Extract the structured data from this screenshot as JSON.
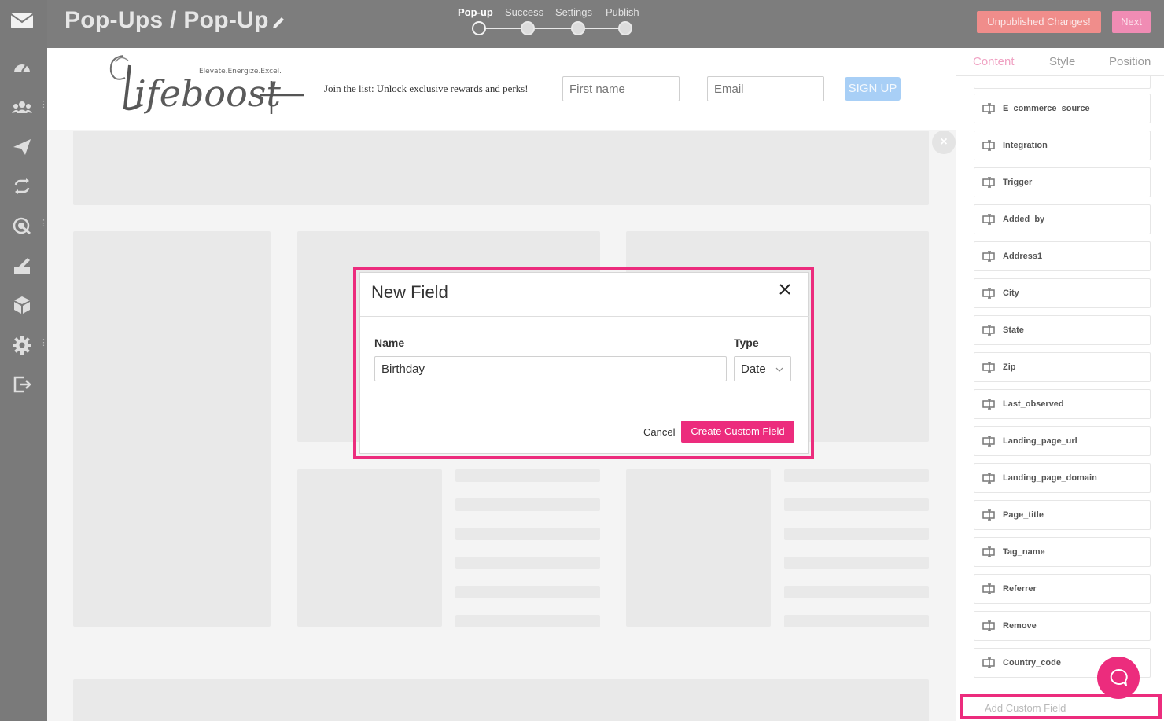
{
  "header": {
    "title": "Pop-Ups / Pop-Up",
    "steps": [
      "Pop-up",
      "Success",
      "Settings",
      "Publish"
    ],
    "active_step": "Pop-up",
    "unpublished_label": "Unpublished Changes!",
    "next_label": "Next"
  },
  "popup": {
    "brand_tagline": "Elevate.Energize.Excel.",
    "join_text": "Join the list: Unlock exclusive rewards and perks!",
    "first_name_placeholder": "First name",
    "email_placeholder": "Email",
    "signup_label": "SIGN UP",
    "close_label": "×"
  },
  "panel": {
    "tabs": [
      "Content",
      "Style",
      "Position"
    ],
    "active_tab": "Content",
    "fields": [
      "E_commerce_source",
      "Integration",
      "Trigger",
      "Added_by",
      "Address1",
      "City",
      "State",
      "Zip",
      "Last_observed",
      "Landing_page_url",
      "Landing_page_domain",
      "Page_title",
      "Tag_name",
      "Referrer",
      "Remove",
      "Country_code"
    ],
    "add_custom_label": "Add Custom Field"
  },
  "modal": {
    "title": "New Field",
    "name_label": "Name",
    "name_value": "Birthday",
    "type_label": "Type",
    "type_value": "Date",
    "cancel_label": "Cancel",
    "create_label": "Create Custom Field"
  },
  "colors": {
    "accent": "#ec2c7d",
    "rail": "#7a7a7a",
    "signup": "#a8cff6"
  }
}
